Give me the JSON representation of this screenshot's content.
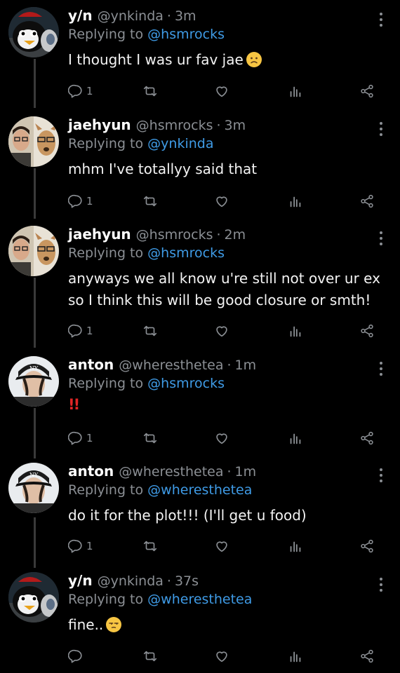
{
  "colors": {
    "background": "#000000",
    "text": "#f3f3f3",
    "muted": "#8b8f94",
    "link": "#3f9be6",
    "alert": "#e02525"
  },
  "tweets": [
    {
      "name": "y/n",
      "handle": "@ynkinda",
      "time": "3m",
      "reply_prefix": "Replying to",
      "reply_to": "@hsmrocks",
      "text": "I thought I was ur fav jae",
      "emoji": "frowning-face",
      "reply_count": "1"
    },
    {
      "name": "jaehyun",
      "handle": "@hsmrocks",
      "time": "3m",
      "reply_prefix": "Replying to",
      "reply_to": "@ynkinda",
      "text": "mhm I've totallyy said that",
      "reply_count": "1"
    },
    {
      "name": "jaehyun",
      "handle": "@hsmrocks",
      "time": "2m",
      "reply_prefix": "Replying to",
      "reply_to": "@hsmrocks",
      "text_line1": "anyways we all know u're still not over ur ex",
      "text_line2": "so I think this will be good closure or smth!",
      "reply_count": "1"
    },
    {
      "name": "anton",
      "handle": "@wheresthetea",
      "time": "1m",
      "reply_prefix": "Replying to",
      "reply_to": "@hsmrocks",
      "text": "!!",
      "reply_count": "1"
    },
    {
      "name": "anton",
      "handle": "@wheresthetea",
      "time": "1m",
      "reply_prefix": "Replying to",
      "reply_to": "@wheresthetea",
      "text": "do it for the plot!!! (I'll get u food)",
      "reply_count": "1"
    },
    {
      "name": "y/n",
      "handle": "@ynkinda",
      "time": "37s",
      "reply_prefix": "Replying to",
      "reply_to": "@wheresthetea",
      "text": "fine..",
      "emoji": "unamused-face",
      "reply_count": ""
    }
  ],
  "separator": "·"
}
